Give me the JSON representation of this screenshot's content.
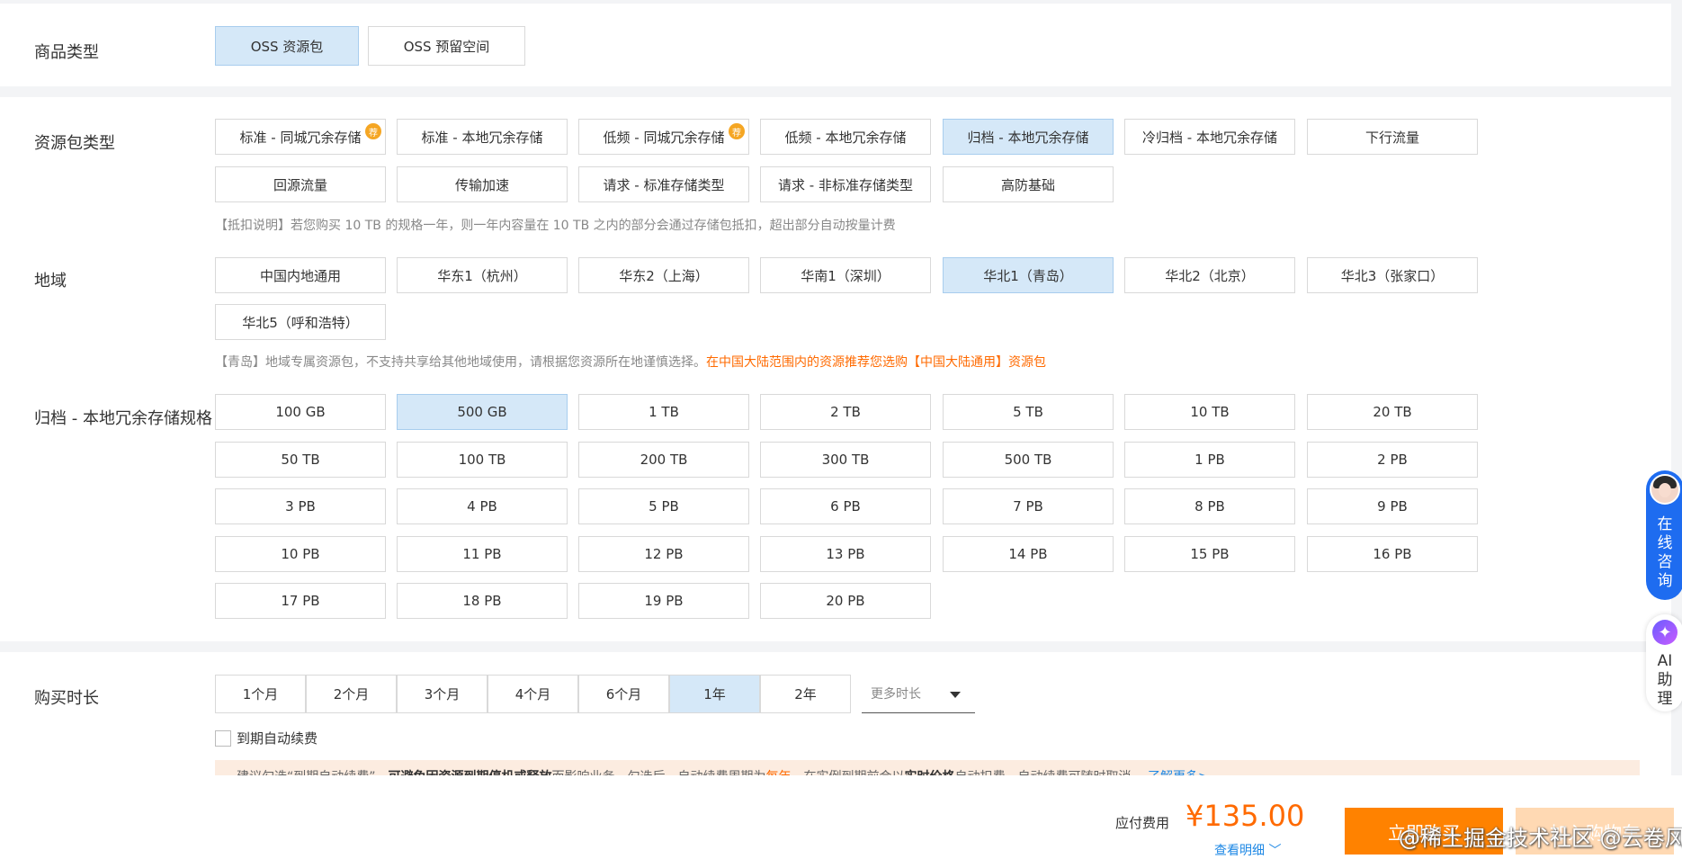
{
  "product_type": {
    "label": "商品类型",
    "options": [
      {
        "label": "OSS 资源包",
        "selected": true
      },
      {
        "label": "OSS 预留空间",
        "selected": false
      }
    ]
  },
  "package_type": {
    "label": "资源包类型",
    "options": [
      {
        "label": "标准 - 同城冗余存储",
        "selected": false,
        "badge": "荐"
      },
      {
        "label": "标准 - 本地冗余存储",
        "selected": false
      },
      {
        "label": "低频 - 同城冗余存储",
        "selected": false,
        "badge": "荐"
      },
      {
        "label": "低频 - 本地冗余存储",
        "selected": false
      },
      {
        "label": "归档 - 本地冗余存储",
        "selected": true
      },
      {
        "label": "冷归档 - 本地冗余存储",
        "selected": false
      },
      {
        "label": "下行流量",
        "selected": false
      },
      {
        "label": "回源流量",
        "selected": false
      },
      {
        "label": "传输加速",
        "selected": false
      },
      {
        "label": "请求 - 标准存储类型",
        "selected": false
      },
      {
        "label": "请求 - 非标准存储类型",
        "selected": false
      },
      {
        "label": "高防基础",
        "selected": false
      }
    ],
    "hint": "【抵扣说明】若您购买 10 TB 的规格一年，则一年内容量在 10 TB 之内的部分会通过存储包抵扣，超出部分自动按量计费"
  },
  "region": {
    "label": "地域",
    "options": [
      {
        "label": "中国内地通用",
        "selected": false
      },
      {
        "label": "华东1（杭州）",
        "selected": false
      },
      {
        "label": "华东2（上海）",
        "selected": false
      },
      {
        "label": "华南1（深圳）",
        "selected": false
      },
      {
        "label": "华北1（青岛）",
        "selected": true
      },
      {
        "label": "华北2（北京）",
        "selected": false
      },
      {
        "label": "华北3（张家口）",
        "selected": false
      },
      {
        "label": "华北5（呼和浩特）",
        "selected": false
      }
    ],
    "hint_text": "【青岛】地域专属资源包，不支持共享给其他地域使用，请根据您资源所在地谨慎选择。",
    "hint_highlight": "在中国大陆范围内的资源推荐您选购【中国大陆通用】资源包"
  },
  "spec": {
    "label": "归档 - 本地冗余存储规格",
    "options": [
      {
        "label": "100 GB",
        "selected": false
      },
      {
        "label": "500 GB",
        "selected": true
      },
      {
        "label": "1 TB",
        "selected": false
      },
      {
        "label": "2 TB",
        "selected": false
      },
      {
        "label": "5 TB",
        "selected": false
      },
      {
        "label": "10 TB",
        "selected": false
      },
      {
        "label": "20 TB",
        "selected": false
      },
      {
        "label": "50 TB",
        "selected": false
      },
      {
        "label": "100 TB",
        "selected": false
      },
      {
        "label": "200 TB",
        "selected": false
      },
      {
        "label": "300 TB",
        "selected": false
      },
      {
        "label": "500 TB",
        "selected": false
      },
      {
        "label": "1 PB",
        "selected": false
      },
      {
        "label": "2 PB",
        "selected": false
      },
      {
        "label": "3 PB",
        "selected": false
      },
      {
        "label": "4 PB",
        "selected": false
      },
      {
        "label": "5 PB",
        "selected": false
      },
      {
        "label": "6 PB",
        "selected": false
      },
      {
        "label": "7 PB",
        "selected": false
      },
      {
        "label": "8 PB",
        "selected": false
      },
      {
        "label": "9 PB",
        "selected": false
      },
      {
        "label": "10 PB",
        "selected": false
      },
      {
        "label": "11 PB",
        "selected": false
      },
      {
        "label": "12 PB",
        "selected": false
      },
      {
        "label": "13 PB",
        "selected": false
      },
      {
        "label": "14 PB",
        "selected": false
      },
      {
        "label": "15 PB",
        "selected": false
      },
      {
        "label": "16 PB",
        "selected": false
      },
      {
        "label": "17 PB",
        "selected": false
      },
      {
        "label": "18 PB",
        "selected": false
      },
      {
        "label": "19 PB",
        "selected": false
      },
      {
        "label": "20 PB",
        "selected": false
      }
    ]
  },
  "duration": {
    "label": "购买时长",
    "options": [
      {
        "label": "1个月",
        "selected": false
      },
      {
        "label": "2个月",
        "selected": false
      },
      {
        "label": "3个月",
        "selected": false
      },
      {
        "label": "4个月",
        "selected": false
      },
      {
        "label": "6个月",
        "selected": false
      },
      {
        "label": "1年",
        "selected": true
      },
      {
        "label": "2年",
        "selected": false
      }
    ],
    "more_label": "更多时长",
    "auto_renew_label": "到期自动续费",
    "notice": {
      "part1": "建议勾选“到期自动续费”，",
      "bold1": "可避免因资源到期停机或释放",
      "part2": "而影响业务。勾选后，自动续费周期为",
      "period": "每年",
      "part3": "，在实例到期前会以",
      "bold2": "实时价格",
      "part4": "自动扣费，自动续费可随时取消。",
      "link": "了解更多>"
    }
  },
  "footer": {
    "fee_label": "应付费用",
    "fee_amount": "¥135.00",
    "detail_link": "查看明细",
    "buy_button": "立即购买",
    "cart_button": "加入购物车",
    "watermark": "@稀土掘金技术社区 @云卷风舒"
  },
  "float": {
    "consult_text": "在线咨询",
    "ai_text": "AI助理"
  },
  "colors": {
    "selected_bg": "#d5e8f8",
    "accent_orange": "#ff6a00",
    "buy_button": "#ff8200",
    "link_blue": "#1e88e5",
    "consult_blue": "#1e6cf0"
  }
}
